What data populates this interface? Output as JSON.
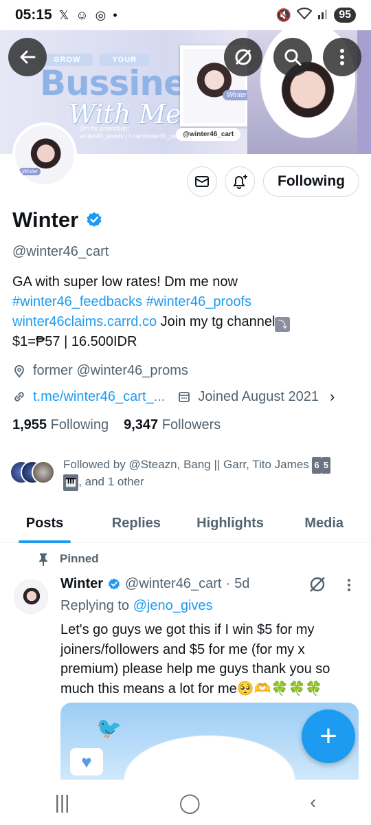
{
  "status_bar": {
    "time": "05:15",
    "battery": "95",
    "left_icons": [
      "x-icon",
      "face-icon",
      "instagram-icon",
      "dot-icon"
    ],
    "right_icons": [
      "mute-icon",
      "wifi-icon",
      "signal-icon"
    ]
  },
  "banner": {
    "pill_left": "GROW",
    "pill_right": "YOUR",
    "headline": "Bussiness",
    "script": "With Me",
    "promo_line1": "Dm for promotion:",
    "promo_line2": "winter46_proofs | t.me/winter46_proofs",
    "photo_caption": "Winter",
    "handle_tag": "@winter46_cart"
  },
  "avatar_tag": "Winter",
  "profile": {
    "name": "Winter",
    "handle": "@winter46_cart",
    "bio_line1": "GA with super low rates! Dm me now",
    "bio_tag1": "#winter46_feedbacks",
    "bio_tag2": "#winter46_proofs",
    "bio_link": "winter46claims.carrd.co",
    "bio_tg": "Join my tg channel",
    "bio_tg_emoji": "⤵",
    "bio_rates": "$1=₱57 | 16.500IDR",
    "location": "former @winter46_proms",
    "website": "t.me/winter46_cart_...",
    "joined": "Joined August 2021",
    "following_count": "1,955",
    "following_label": "Following",
    "followers_count": "9,347",
    "followers_label": "Followers"
  },
  "actions": {
    "follow_label": "Following"
  },
  "followed_by": {
    "text": "Followed by @Steazn, Bang || Garr, Tito James",
    "badge1": "6",
    "badge2": "5",
    "badge3": "🎹",
    "tail": ", and 1 other"
  },
  "tabs": [
    "Posts",
    "Replies",
    "Highlights",
    "Media"
  ],
  "post": {
    "pinned_label": "Pinned",
    "author": "Winter",
    "handle": "@winter46_cart",
    "sep": "·",
    "time": "5d",
    "replying_prefix": "Replying to",
    "replying_to": "@jeno_gives",
    "text": "Let's go guys we got this if I win $5 for my joiners/followers and $5 for me (for my x premium) please help me guys thank you so much this means a lot for me🥺🫶🍀🍀🍀"
  },
  "fab_label": "+",
  "nav": {
    "recents": "|||",
    "home": "◯",
    "back": "‹"
  },
  "colors": {
    "accent": "#1d9bf0",
    "text": "#0f1419",
    "muted": "#536471"
  }
}
